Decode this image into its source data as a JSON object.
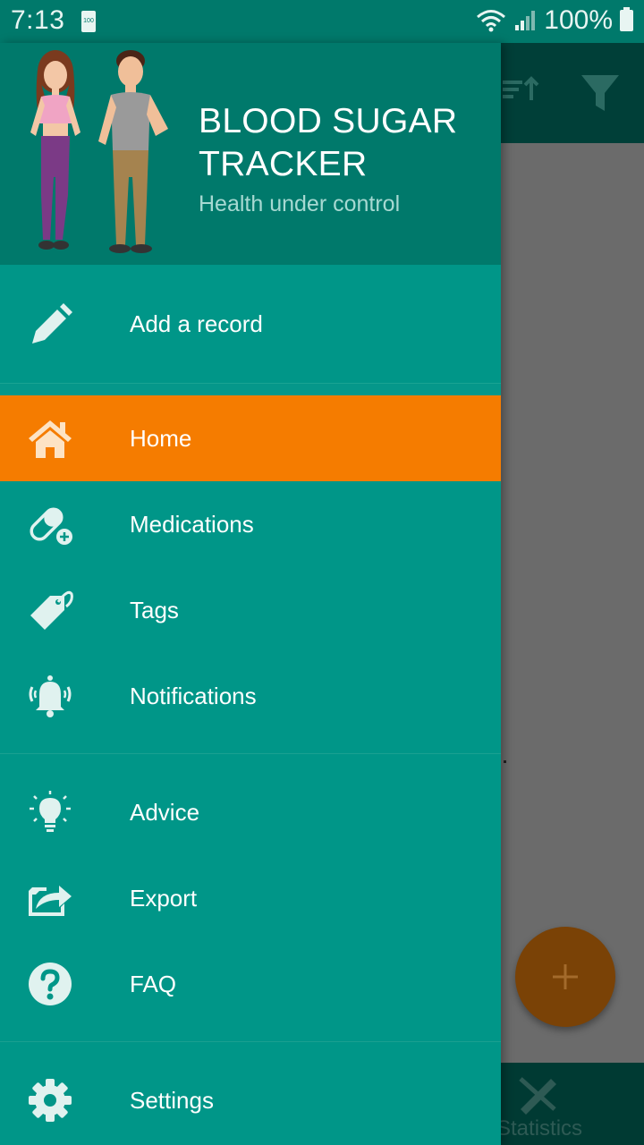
{
  "status_bar": {
    "time": "7:13",
    "battery_small_text": "100",
    "battery_percent": "100%"
  },
  "background_app": {
    "bottom_nav_label": "Statistics"
  },
  "drawer": {
    "title": "BLOOD SUGAR TRACKER",
    "subtitle": "Health under control",
    "items": [
      {
        "label": "Add a record",
        "icon": "pencil-icon"
      },
      {
        "label": "Home",
        "icon": "home-icon",
        "active": true
      },
      {
        "label": "Medications",
        "icon": "pill-icon"
      },
      {
        "label": "Tags",
        "icon": "tag-icon"
      },
      {
        "label": "Notifications",
        "icon": "bell-icon"
      },
      {
        "label": "Advice",
        "icon": "lightbulb-icon"
      },
      {
        "label": "Export",
        "icon": "export-icon"
      },
      {
        "label": "FAQ",
        "icon": "help-icon"
      },
      {
        "label": "Settings",
        "icon": "gear-icon"
      }
    ]
  },
  "colors": {
    "drawer_bg": "#009688",
    "header_bg": "#00796b",
    "active_item": "#f57c00",
    "fab": "#7a4206"
  }
}
